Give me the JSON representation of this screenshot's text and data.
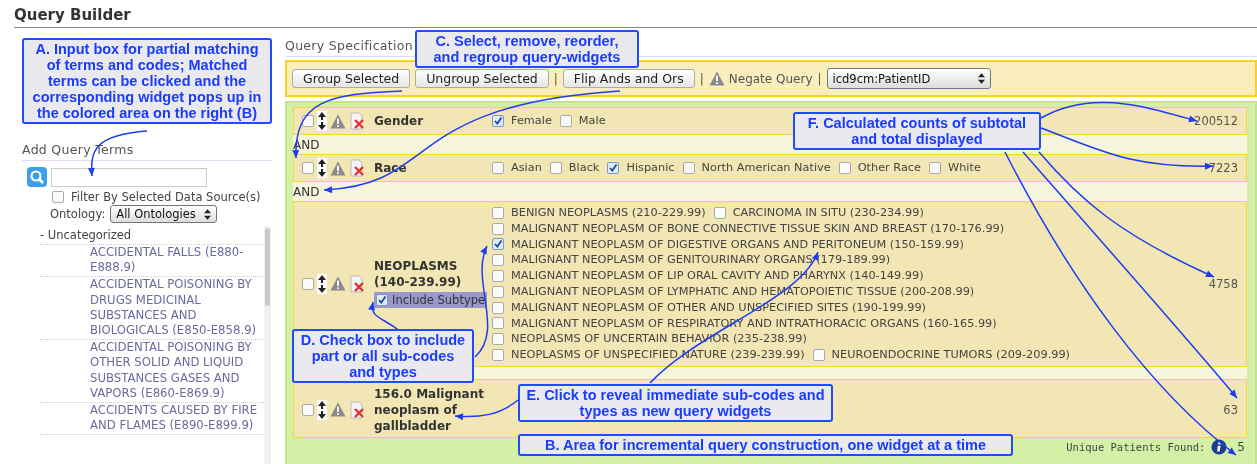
{
  "title": "Query Builder",
  "annotations": [
    {
      "text": "A. Input box for partial matching of terms and codes; Matched terms can be clicked and the corresponding widget pops up in the colored area on the right (B)"
    },
    {
      "text": "C. Select, remove, reorder, and regroup query-widgets"
    },
    {
      "text": "F. Calculated counts of subtotal and total displayed"
    },
    {
      "text": "D. Check box to include part or all sub-codes and types"
    },
    {
      "text": "E. Click to reveal immediate sub-codes and types as new query widgets"
    },
    {
      "text": "B. Area for incremental query construction, one widget at a time"
    }
  ],
  "sidebar": {
    "heading": "Add Query Terms",
    "filter": {
      "label": "Filter By Selected Data Source(s)",
      "checked": false
    },
    "ontology": {
      "label": "Ontology:",
      "value": "All Ontologies"
    },
    "tree": [
      {
        "label": "- Uncategorized",
        "children": [
          {
            "label": "ACCIDENTAL FALLS (E880-E888.9)"
          },
          {
            "label": "ACCIDENTAL POISONING BY DRUGS MEDICINAL SUBSTANCES AND BIOLOGICALS (E850-E858.9)"
          },
          {
            "label": "ACCIDENTAL POISONING BY OTHER SOLID AND LIQUID SUBSTANCES GASES AND VAPORS (E860-E869.9)"
          },
          {
            "label": "ACCIDENTS CAUSED BY FIRE AND FLAMES (E890-E899.9)"
          }
        ]
      }
    ]
  },
  "query_spec": {
    "heading": "Query Specification",
    "toolbar": [
      {
        "kind": "button",
        "label": "Group Selected"
      },
      {
        "kind": "button",
        "label": "Ungroup Selected"
      },
      {
        "kind": "separator",
        "text": "|"
      },
      {
        "kind": "button",
        "label": "Flip Ands and Ors"
      },
      {
        "kind": "separator",
        "text": "|"
      },
      {
        "kind": "negate",
        "label": "Negate Query"
      },
      {
        "kind": "separator",
        "text": "|"
      },
      {
        "kind": "select",
        "value": "icd9cm:PatientID"
      }
    ],
    "items": [
      {
        "kind": "widget",
        "label": "Gender",
        "selected": false,
        "count": "200512",
        "option_rows": [
          [
            {
              "label": "Female",
              "checked": true
            },
            {
              "label": "Male",
              "checked": false
            }
          ]
        ]
      },
      {
        "kind": "connector",
        "text": "AND"
      },
      {
        "kind": "widget",
        "label": "Race",
        "selected": false,
        "count": "7223",
        "option_rows": [
          [
            {
              "label": "Asian",
              "checked": false
            },
            {
              "label": "Black",
              "checked": false
            },
            {
              "label": "Hispanic",
              "checked": true
            },
            {
              "label": "North American Native",
              "checked": false
            },
            {
              "label": "Other Race",
              "checked": false
            },
            {
              "label": "White",
              "checked": false
            }
          ]
        ]
      },
      {
        "kind": "connector",
        "text": "AND"
      },
      {
        "kind": "widget",
        "label": "NEOPLASMS (140-239.99)",
        "selected": false,
        "count": "4758",
        "include_subtype": {
          "label": "Include Subtype",
          "checked": true
        },
        "option_rows": [
          [
            {
              "label": "BENIGN NEOPLASMS (210-229.99)",
              "checked": false
            },
            {
              "label": "CARCINOMA IN SITU (230-234.99)",
              "checked": false
            }
          ],
          [
            {
              "label": "MALIGNANT NEOPLASM OF BONE CONNECTIVE TISSUE SKIN AND BREAST (170-176.99)",
              "checked": false
            }
          ],
          [
            {
              "label": "MALIGNANT NEOPLASM OF DIGESTIVE ORGANS AND PERITONEUM (150-159.99)",
              "checked": true
            }
          ],
          [
            {
              "label": "MALIGNANT NEOPLASM OF GENITOURINARY ORGANS (179-189.99)",
              "checked": false
            }
          ],
          [
            {
              "label": "MALIGNANT NEOPLASM OF LIP ORAL CAVITY AND PHARYNX (140-149.99)",
              "checked": false
            }
          ],
          [
            {
              "label": "MALIGNANT NEOPLASM OF LYMPHATIC AND HEMATOPOIETIC TISSUE (200-208.99)",
              "checked": false
            }
          ],
          [
            {
              "label": "MALIGNANT NEOPLASM OF OTHER AND UNSPECIFIED SITES (190-199.99)",
              "checked": false
            }
          ],
          [
            {
              "label": "MALIGNANT NEOPLASM OF RESPIRATORY AND INTRATHORACIC ORGANS (160-165.99)",
              "checked": false
            }
          ],
          [
            {
              "label": "NEOPLASMS OF UNCERTAIN BEHAVIOR (235-238.99)",
              "checked": false
            }
          ],
          [
            {
              "label": "NEOPLASMS OF UNSPECIFIED NATURE (239-239.99)",
              "checked": false
            },
            {
              "label": "NEUROENDOCRINE TUMORS (209-209.99)",
              "checked": false
            }
          ]
        ]
      },
      {
        "kind": "connector"
      },
      {
        "kind": "widget",
        "label": "156.0 Malignant neoplasm of gallbladder",
        "selected": false,
        "count": "63"
      }
    ],
    "footer": {
      "label": "Unique Patients Found:",
      "count": "5"
    }
  }
}
